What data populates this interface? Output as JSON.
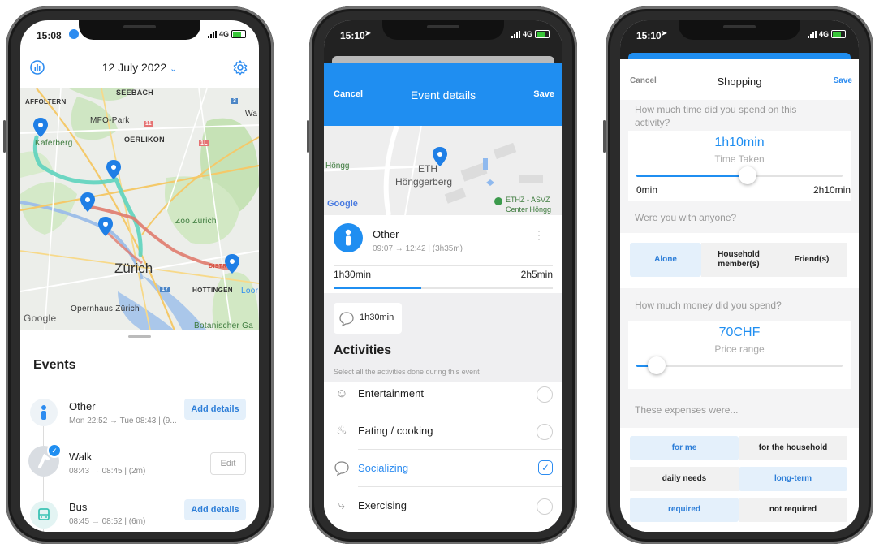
{
  "phone1": {
    "time": "15:08",
    "network": "4G",
    "date": "12 July 2022",
    "map_labels": {
      "seebach": "SEEBACH",
      "affoltern": "AFFOLTERN",
      "mfo_park": "MFO-Park",
      "oerlikon": "OERLIKON",
      "kaeferberg": "Käferberg",
      "zoo": "Zoo Zürich",
      "city": "Zürich",
      "hottingen": "HOTTINGEN",
      "opernhaus": "Opernhaus Zürich",
      "botanischer": "Botanischer Ga",
      "wa": "Wa",
      "loor": "Loor",
      "distr": "DISTR",
      "google": "Google",
      "road_11": "11",
      "road_1l": "1L",
      "road_17": "17",
      "road_3": "3"
    },
    "events_title": "Events",
    "events": [
      {
        "title": "Other",
        "meta": "Mon 22:52  →  Tue 08:43 | (9...",
        "action": "Add details"
      },
      {
        "title": "Walk",
        "meta": "08:43  →  08:45 | (2m)",
        "action": "Edit"
      },
      {
        "title": "Bus",
        "meta": "08:45  →  08:52 | (6m)",
        "action": "Add details"
      }
    ]
  },
  "phone2": {
    "time": "15:10",
    "network": "4G",
    "header": {
      "cancel": "Cancel",
      "title": "Event details",
      "save": "Save"
    },
    "map_labels": {
      "hoengg": "Höngg",
      "eth": "ETH",
      "hoenggerberg": "Hönggerberg",
      "asvz1": "ETHZ - ASVZ",
      "asvz2": "Center Höngg",
      "google": "Google"
    },
    "event": {
      "title": "Other",
      "time": "09:07  →  12:42 | (3h35m)",
      "start": "1h30min",
      "end": "2h5min",
      "progress": 0.4
    },
    "duration_chip": "1h30min",
    "activities_title": "Activities",
    "activities_hint": "Select all the activities done during this event",
    "activities": [
      {
        "label": "Entertainment",
        "checked": false
      },
      {
        "label": "Eating  / cooking",
        "checked": false
      },
      {
        "label": "Socializing",
        "checked": true
      },
      {
        "label": "Exercising",
        "checked": false
      }
    ]
  },
  "phone3": {
    "time": "15:10",
    "network": "4G",
    "header": {
      "cancel": "Cancel",
      "title": "Shopping",
      "save": "Save"
    },
    "q_time": "How much time did you spend on this activity?",
    "time_value": "1h10min",
    "time_caption": "Time Taken",
    "time_min": "0min",
    "time_max": "2h10min",
    "time_fraction": 0.54,
    "q_company": "Were you with anyone?",
    "company": [
      {
        "label": "Alone",
        "selected": true
      },
      {
        "label": "Household member(s)",
        "selected": false
      },
      {
        "label": "Friend(s)",
        "selected": false
      }
    ],
    "q_money": "How much money did you spend?",
    "money_value": "70CHF",
    "money_caption": "Price range",
    "money_fraction": 0.1,
    "q_expenses": "These expenses were...",
    "expenses": [
      [
        {
          "label": "for me",
          "selected": true
        },
        {
          "label": "for the household",
          "selected": false
        }
      ],
      [
        {
          "label": "daily needs",
          "selected": false
        },
        {
          "label": "long-term",
          "selected": true
        }
      ],
      [
        {
          "label": "required",
          "selected": true
        },
        {
          "label": "not required",
          "selected": false
        }
      ]
    ]
  }
}
